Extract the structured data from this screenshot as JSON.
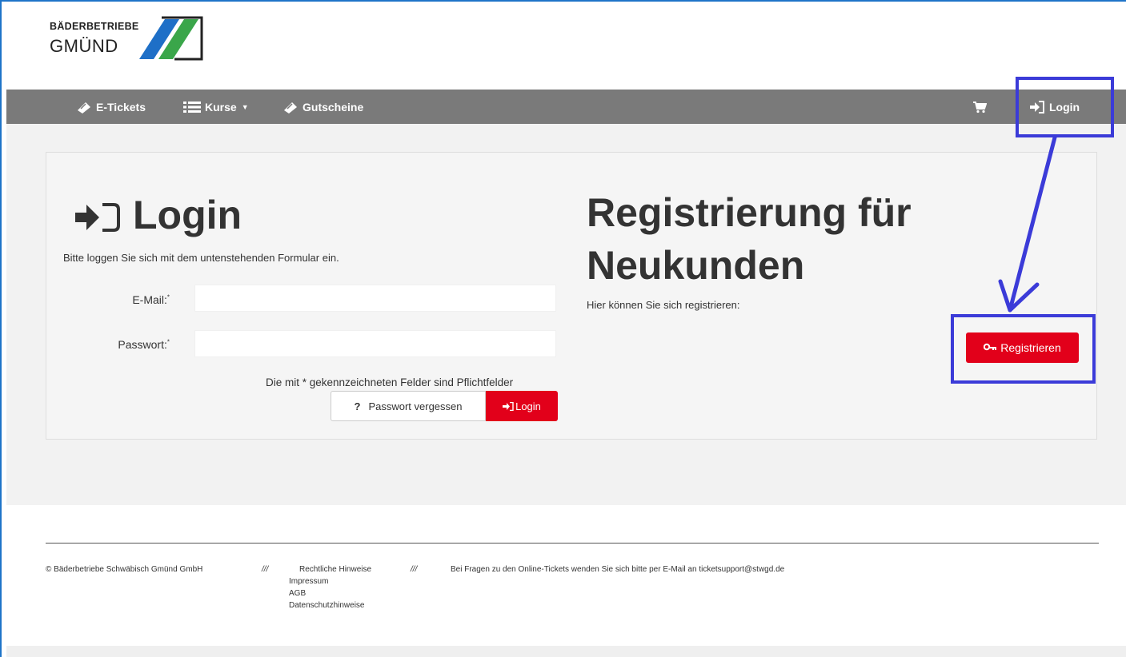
{
  "brand": {
    "logo_top": "BÄDERBETRIEBE",
    "logo_bottom": "GMÜND",
    "colors": {
      "blue": "#1e6fc7",
      "green": "#3aa64a",
      "dark": "#222222"
    }
  },
  "nav": {
    "items": [
      {
        "label": "E-Tickets",
        "icon": "ticket-icon"
      },
      {
        "label": "Kurse",
        "icon": "list-icon"
      },
      {
        "label": "Gutscheine",
        "icon": "ticket-icon"
      }
    ],
    "cart_icon": "cart-icon",
    "login_label": "Login",
    "bg_color": "#7a7a7a"
  },
  "login": {
    "heading": "Login",
    "subtitle": "Bitte loggen Sie sich mit dem untenstehenden Formular ein.",
    "email_label": "E-Mail:",
    "password_label": "Passwort:",
    "required_marker": "*",
    "email_value": "",
    "password_value": "",
    "required_note": "Die mit * gekennzeichneten Felder sind Pflichtfelder",
    "forgot_label": "Passwort vergessen",
    "forgot_icon": "?",
    "submit_label": "Login"
  },
  "register": {
    "heading_line1": "Registrierung für",
    "heading_line2": "Neukunden",
    "subtitle": "Hier können Sie sich registrieren:",
    "button_label": "Registrieren",
    "button_color": "#e2001a"
  },
  "footer": {
    "copyright": "© Bäderbetriebe Schwäbisch Gmünd GmbH",
    "separator": "///",
    "legal_title": "Rechtliche Hinweise",
    "links": [
      "Impressum",
      "AGB",
      "Datenschutzhinweise"
    ],
    "contact": "Bei Fragen zu den Online-Tickets wenden Sie sich bitte per E-Mail an ticketsupport@stwgd.de"
  },
  "annotation": {
    "color": "#3b3bd8"
  }
}
